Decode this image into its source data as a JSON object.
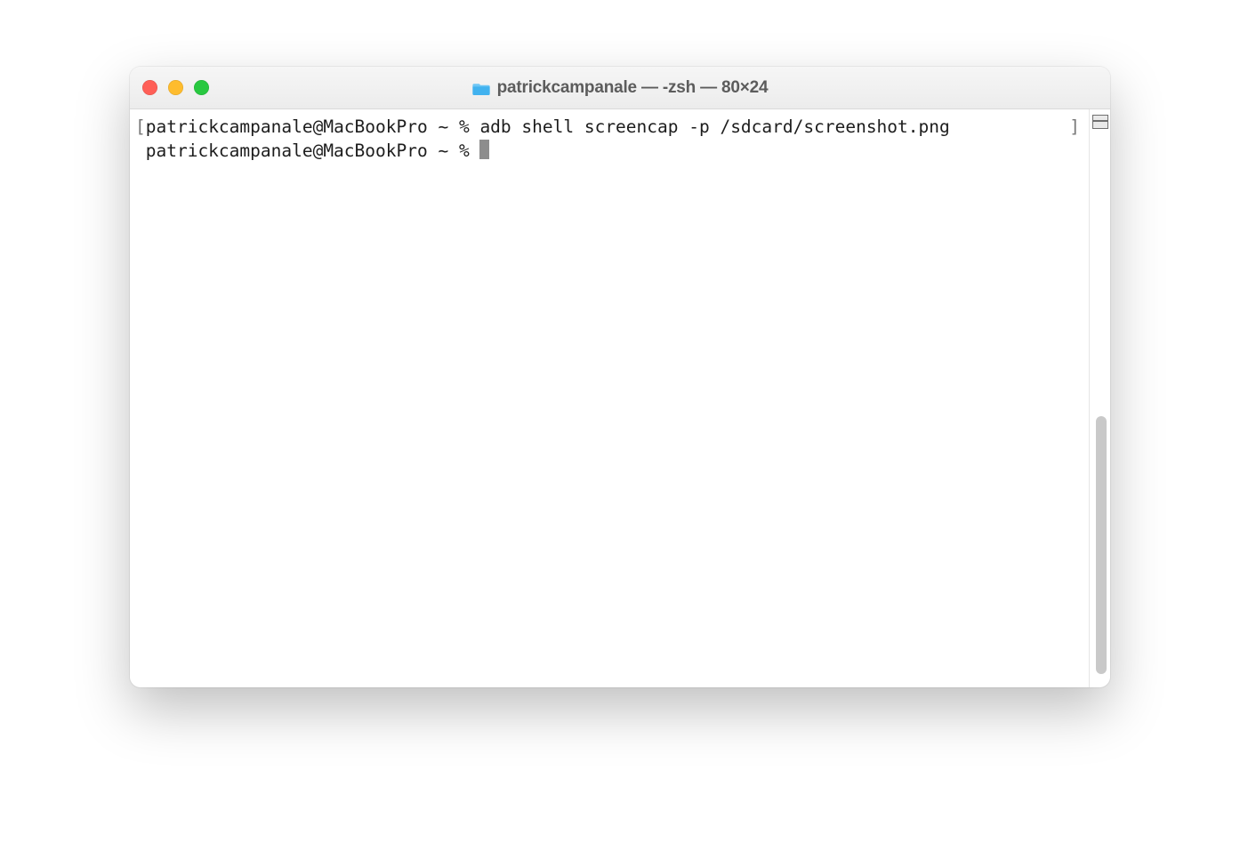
{
  "window": {
    "title": "patrickcampanale — -zsh — 80×24"
  },
  "terminal": {
    "bracket_open": "[",
    "bracket_close": "]",
    "line1_prompt": "patrickcampanale@MacBookPro ~ % ",
    "line1_cmd": "adb shell screencap -p /sdcard/screenshot.png",
    "line2_prompt": " patrickcampanale@MacBookPro ~ % "
  }
}
